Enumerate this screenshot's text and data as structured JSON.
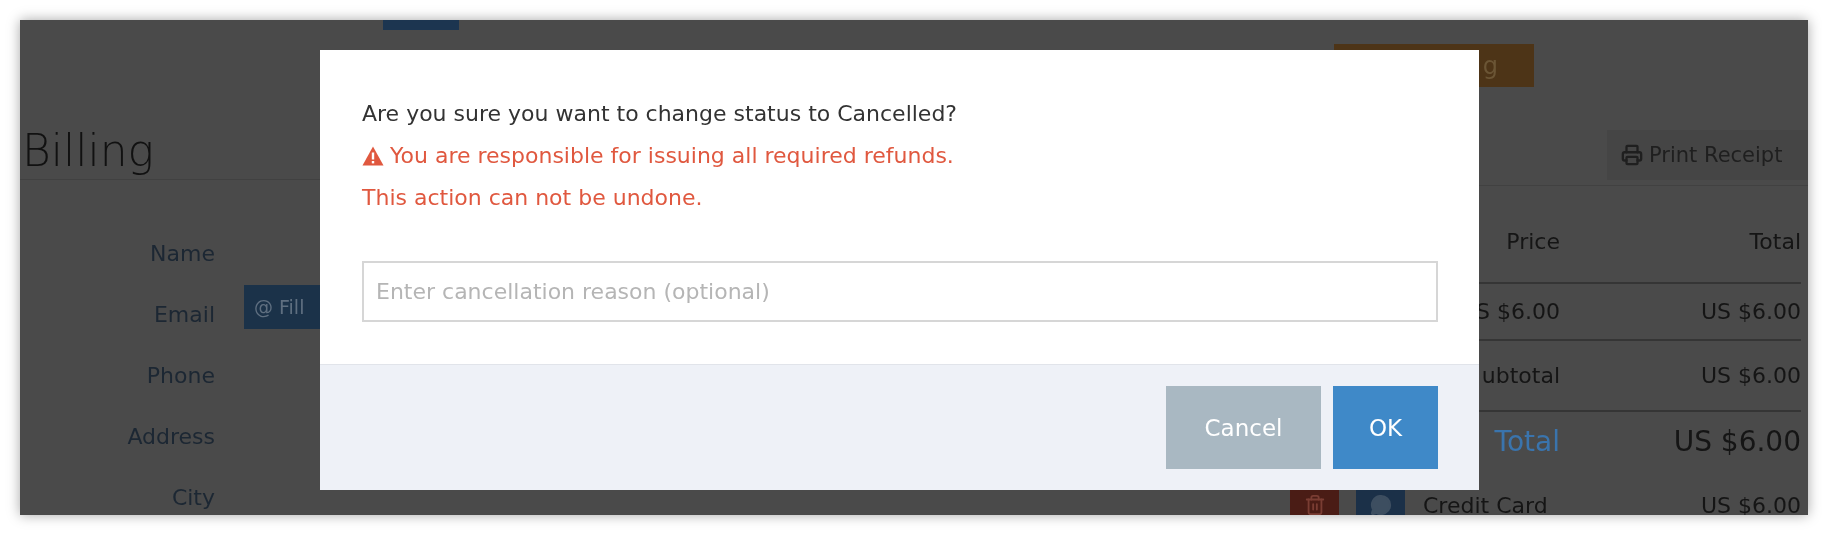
{
  "page": {
    "status_button": {
      "label": "g"
    },
    "billing": {
      "title": "Billing",
      "fields": [
        {
          "label": "Name"
        },
        {
          "label": "Email",
          "action": "@ Fill"
        },
        {
          "label": "Phone"
        },
        {
          "label": "Address"
        },
        {
          "label": "City"
        }
      ]
    },
    "print_button": {
      "label": "Print Receipt"
    },
    "table": {
      "columns": [
        "Price",
        "Total"
      ],
      "rows": [
        {
          "kind": "item",
          "label": "S $6.00",
          "total": "US $6.00"
        },
        {
          "kind": "subtotal",
          "label": "ubtotal",
          "total": "US $6.00"
        },
        {
          "kind": "total",
          "label": "Total",
          "total": "US $6.00"
        },
        {
          "kind": "payment",
          "label": "Credit Card",
          "total": "US $6.00"
        }
      ]
    }
  },
  "dialog": {
    "question": "Are you sure you want to change status to Cancelled?",
    "warning": "You are responsible for issuing all required refunds.",
    "note": "This action can not be undone.",
    "input": {
      "placeholder": "Enter cancellation reason (optional)"
    },
    "buttons": [
      {
        "label": "Cancel",
        "kind": "secondary"
      },
      {
        "label": "OK",
        "kind": "primary"
      }
    ]
  }
}
